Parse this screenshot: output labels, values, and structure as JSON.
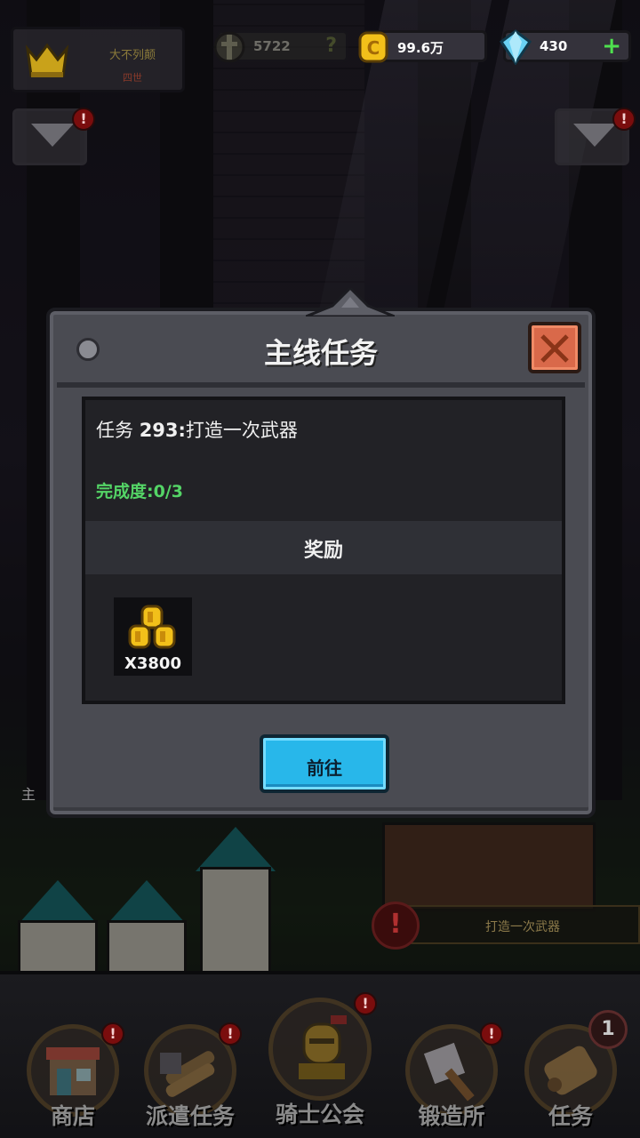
{
  "player": {
    "name": "大不列颠",
    "subtitle": "四世"
  },
  "resources": {
    "power": {
      "value": "5722",
      "help": "?"
    },
    "gold": {
      "value": "99.6万"
    },
    "gems": {
      "value": "430",
      "add": "+"
    }
  },
  "alert_mark": "!",
  "dialog": {
    "title": "主线任务",
    "task_prefix": "任务 ",
    "task_number": "293:",
    "task_name": "打造一次武器",
    "progress": "完成度:0/3",
    "reward_title": "奖励",
    "reward_count": "X3800",
    "go_button": "前往"
  },
  "quest_hint": {
    "text": "打造一次武器",
    "alert": "!"
  },
  "left_tag": "主",
  "nav": {
    "items": [
      {
        "label": "商店"
      },
      {
        "label": "派遣任务"
      },
      {
        "label": "骑士公会"
      },
      {
        "label": "锻造所"
      },
      {
        "label": "任务",
        "badge": "1"
      }
    ]
  },
  "colors": {
    "accent_blue": "#28b7ea",
    "close_red": "#d9694a",
    "progress_green": "#54d466",
    "gold": "#f2c01a"
  }
}
